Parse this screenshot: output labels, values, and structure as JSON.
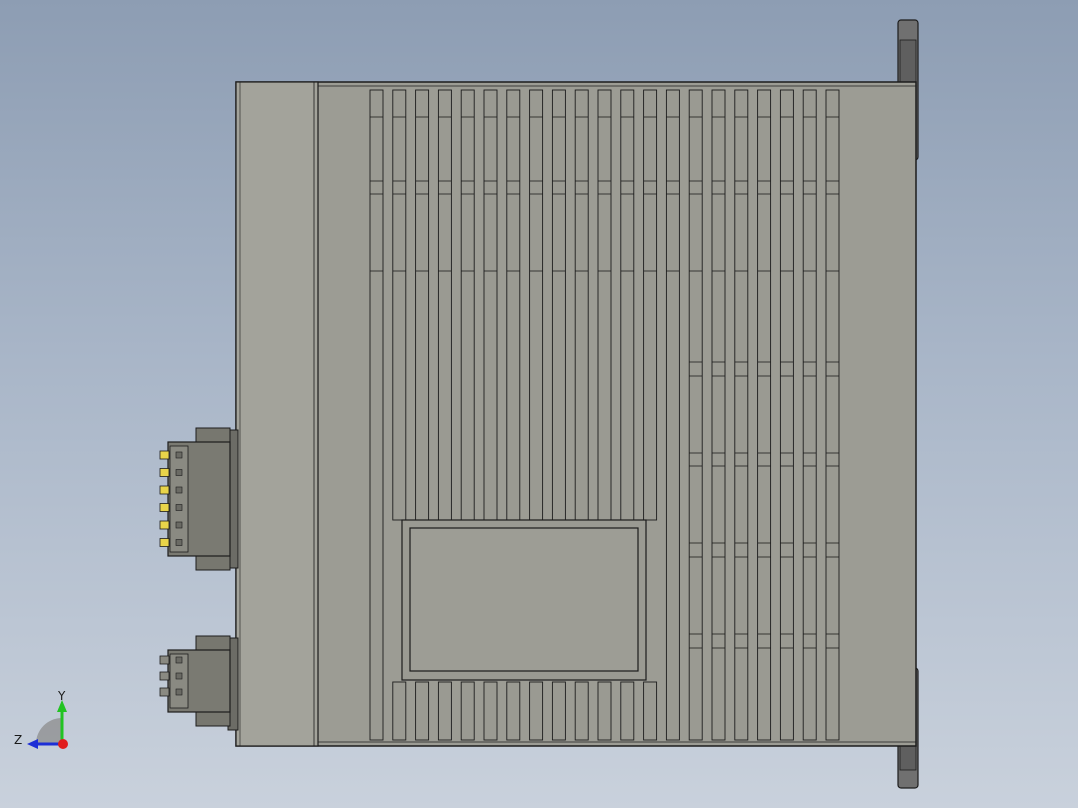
{
  "view": {
    "background_top": "#8d9db3",
    "background_bottom": "#c9d1dc",
    "body_color": "#9c9c94",
    "edge_color": "#1c1c1c",
    "pin_color": "#e8d44a"
  },
  "model": {
    "vent_columns": 21,
    "pins_top_connector": 6,
    "pins_bottom_connector": 3
  },
  "triad": {
    "y_label": "Y",
    "z_label": "Z",
    "y_color": "#22c322",
    "z_color": "#1d2fd6",
    "x_color": "#e01c1c"
  }
}
